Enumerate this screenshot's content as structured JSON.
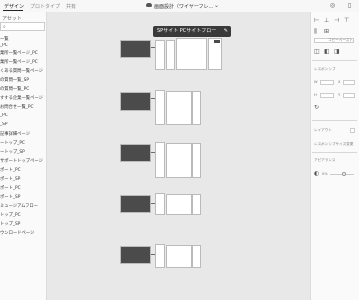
{
  "tabs": [
    {
      "label": "デザイン"
    },
    {
      "label": "プロトタイプ"
    },
    {
      "label": "共有"
    }
  ],
  "document": {
    "title": "画面設計（ワイヤーフレ..."
  },
  "left_panel": {
    "heading": "アセット",
    "items": [
      {
        "label": "一覧"
      },
      {
        "label": "_PC"
      },
      {
        "label": "業所一覧ページ_PC"
      },
      {
        "label": "業所一覧ページ_PC"
      },
      {
        "label": "くある質問一覧ページ"
      },
      {
        "label": "の質問一覧_SP"
      },
      {
        "label": "の質問一覧_PC"
      },
      {
        "label": "すする企業一覧ページ"
      },
      {
        "label": "お問合せ一覧_PC"
      },
      {
        "label": "_PC"
      },
      {
        "label": "_SP"
      },
      {
        "label": "記事詳細ページ"
      },
      {
        "label": "ートップ_PC"
      },
      {
        "label": "ートップ_SP"
      },
      {
        "label": "サポートトップページ"
      },
      {
        "label": "ポート_PC"
      },
      {
        "label": "ポート_SP"
      },
      {
        "label": "ポート_PC"
      },
      {
        "label": "ポート_SP"
      },
      {
        "label": "ミュージアムフロー"
      },
      {
        "label": "トップ_PC"
      },
      {
        "label": "トップ_SP"
      },
      {
        "label": "ウンロードページ"
      }
    ]
  },
  "canvas": {
    "tooltip": "SPサイト PCサイトフロー"
  },
  "right_panel": {
    "texts": [
      {
        "label": "コピーペースト"
      },
      {
        "label": "レスポンシブ"
      },
      {
        "label": "W"
      },
      {
        "label": "X"
      },
      {
        "label": "H"
      },
      {
        "label": "Y"
      },
      {
        "label": "レイアウト"
      },
      {
        "label": "レスポンシブサイズ変更"
      },
      {
        "label": "アピアランス"
      },
      {
        "label": "0%"
      }
    ]
  }
}
